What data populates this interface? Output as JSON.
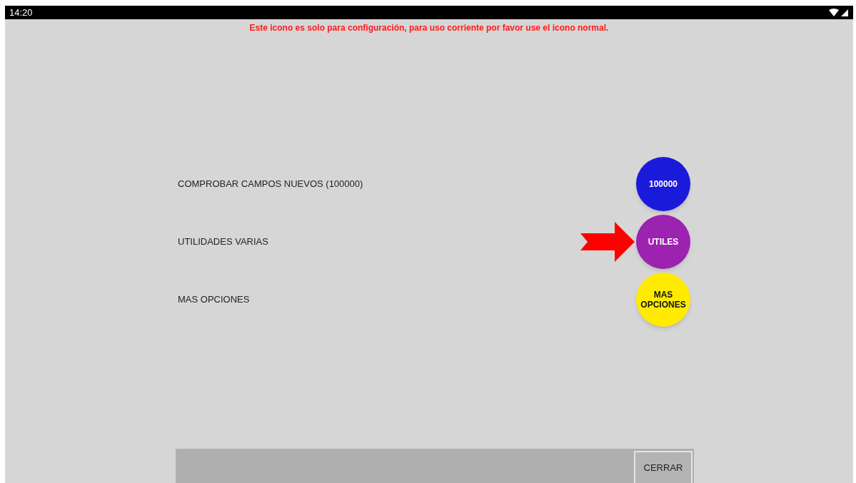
{
  "status_bar": {
    "time": "14:20"
  },
  "notice": "Este icono es solo para configuración, para uso corriente por favor use el icono normal.",
  "options": [
    {
      "label": "COMPROBAR CAMPOS NUEVOS (100000)",
      "button": "100000",
      "color": "#1a1adb",
      "pointed": false
    },
    {
      "label": "UTILIDADES VARIAS",
      "button": "UTILES",
      "color": "#9c22b0",
      "pointed": true
    },
    {
      "label": "MAS OPCIONES",
      "button": "MAS OPCIONES",
      "color": "#ffea00",
      "pointed": false
    }
  ],
  "footer": {
    "close_button": "CERRAR"
  }
}
